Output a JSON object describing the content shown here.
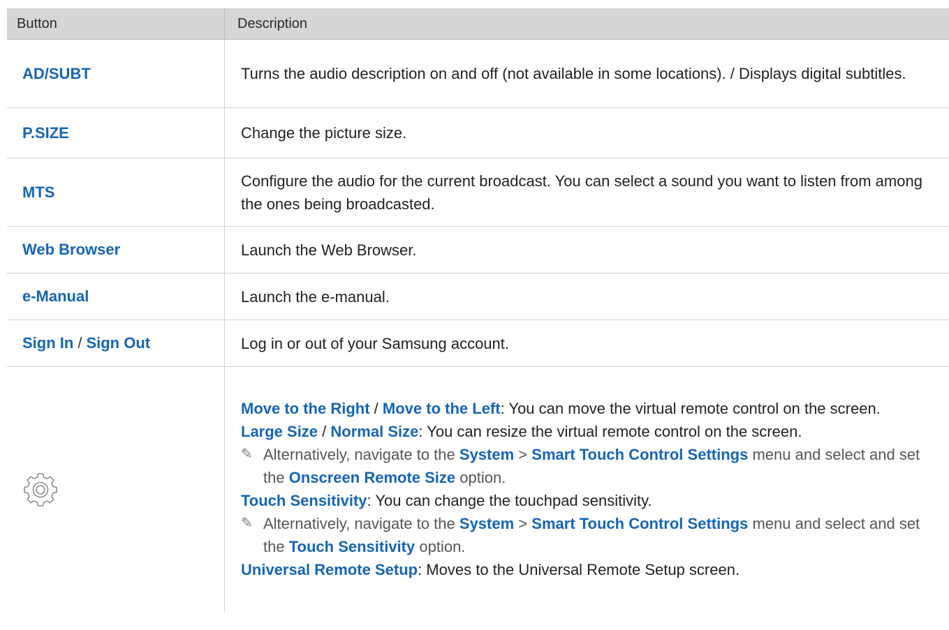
{
  "header": {
    "col1": "Button",
    "col2": "Description"
  },
  "rows": [
    {
      "button": "AD/SUBT",
      "desc": "Turns the audio description on and off (not available in some locations). / Displays digital subtitles."
    },
    {
      "button": "P.SIZE",
      "desc": "Change the picture size."
    },
    {
      "button": "MTS",
      "desc": "Configure the audio for the current broadcast. You can select a sound you want to listen from among the ones being broadcasted."
    },
    {
      "button": "Web Browser",
      "desc": "Launch the Web Browser."
    },
    {
      "button": "e-Manual",
      "desc": "Launch the e-manual."
    },
    {
      "button_a": "Sign In",
      "button_sep": "/",
      "button_b": "Sign Out",
      "desc": "Log in or out of your Samsung account."
    }
  ],
  "settings_row": {
    "icon": "gear-icon",
    "move_right": "Move to the Right",
    "move_sep": "/",
    "move_left": "Move to the Left",
    "move_desc": ": You can move the virtual remote control on the screen.",
    "large_size": "Large Size",
    "size_sep": "/",
    "normal_size": "Normal Size",
    "size_desc": ": You can resize the virtual remote control on the screen.",
    "note1_pre": "Alternatively, navigate to the",
    "note1_system": "System",
    "note1_arrow": ">",
    "note1_menu": "Smart Touch Control Settings",
    "note1_mid": "menu and select and set the",
    "note1_option": "Onscreen Remote Size",
    "note1_post": "option.",
    "touch_sensitivity": "Touch Sensitivity",
    "touch_desc": ": You can change the touchpad sensitivity.",
    "note2_pre": "Alternatively, navigate to the",
    "note2_system": "System",
    "note2_arrow": ">",
    "note2_menu": "Smart Touch Control Settings",
    "note2_mid": "menu and select and set the",
    "note2_option": "Touch Sensitivity",
    "note2_post": "option.",
    "universal_setup": "Universal Remote Setup",
    "universal_desc": ": Moves to the Universal Remote Setup screen."
  },
  "colors": {
    "link": "#1565b6",
    "header_bg": "#d6d6d6",
    "border": "#cfcfcf"
  }
}
